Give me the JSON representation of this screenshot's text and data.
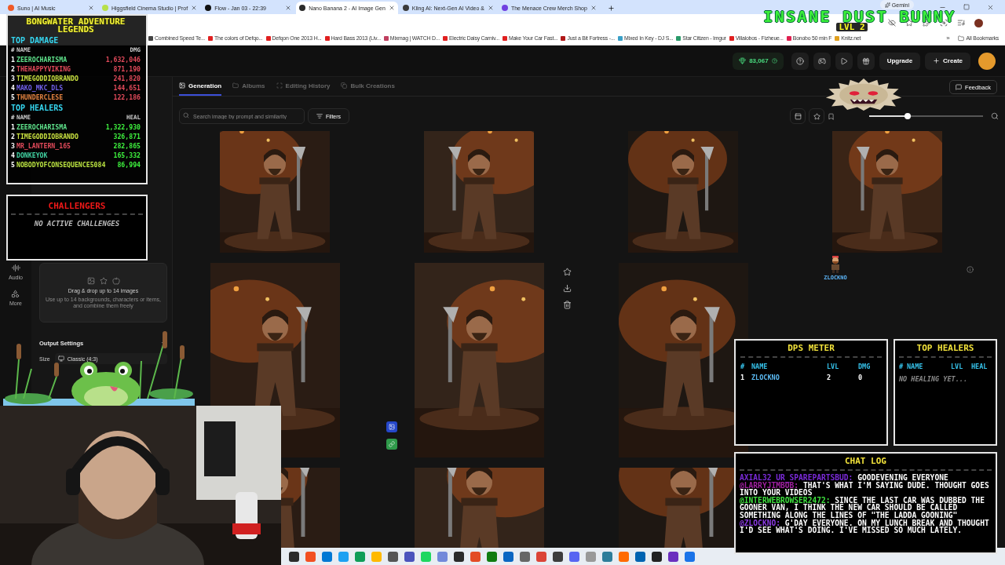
{
  "browser": {
    "tabs": [
      {
        "title": "Suno | AI Music",
        "selected": false,
        "color": "#f05a28"
      },
      {
        "title": "Higgsfield Cinema Studio | Prof",
        "selected": false,
        "color": "#b7e04a"
      },
      {
        "title": "Flow - Jan 03 - 22:39",
        "selected": false,
        "color": "#111111"
      },
      {
        "title": "Nano Banana 2 - AI Image Gen",
        "selected": true,
        "color": "#2a2a2a"
      },
      {
        "title": "Kling AI: Next-Gen AI Video &",
        "selected": false,
        "color": "#3a3a3a"
      },
      {
        "title": "The Menace Crew Merch Shop",
        "selected": false,
        "color": "#7040e0"
      }
    ],
    "gemini": "Gemini",
    "bookmarks": [
      {
        "title": "Combined Speed Te...",
        "color": "#444444"
      },
      {
        "title": "The colors of Defqo...",
        "color": "#e02020"
      },
      {
        "title": "Defqon One 2013 H...",
        "color": "#e02020"
      },
      {
        "title": "Hard Bass 2013 (Liv...",
        "color": "#e02020"
      },
      {
        "title": "Mixmag | WATCH D...",
        "color": "#c04060"
      },
      {
        "title": "Electric Daisy Carniv...",
        "color": "#e02020"
      },
      {
        "title": "Make Your Car Fast...",
        "color": "#e02020"
      },
      {
        "title": "Just a Bit Fortress -...",
        "color": "#b01818"
      },
      {
        "title": "Mixed In Key - DJ S...",
        "color": "#3aa0c8"
      },
      {
        "title": "Star Citizen - Imgur",
        "color": "#2a9a6a"
      },
      {
        "title": "Villalobos - Fizheue...",
        "color": "#e02020"
      },
      {
        "title": "Bonobo 50 min F",
        "color": "#e02050"
      },
      {
        "title": "Knitz.net",
        "color": "#e0a020"
      }
    ],
    "more_bookmarks": "»",
    "all_bookmarks": "All Bookmarks"
  },
  "app": {
    "credits": "83,067",
    "upgrade": "Upgrade",
    "create": "Create",
    "tabs": [
      {
        "label": "Generation",
        "selected": true
      },
      {
        "label": "Albums",
        "selected": false
      },
      {
        "label": "Editing History",
        "selected": false
      },
      {
        "label": "Bulk Creations",
        "selected": false
      }
    ],
    "feedback": "Feedback",
    "nav": [
      {
        "label": "Audio"
      },
      {
        "label": "More"
      }
    ],
    "upload": {
      "title": "Drag & drop up to 14 images",
      "hint": "Use up to 14 backgrounds, characters or items, and combine them freely"
    },
    "output": {
      "title": "Output Settings",
      "size_label": "Size",
      "size_value": "Classic (4:3)"
    },
    "search_placeholder": "Search image by prompt and similarity",
    "filters": "Filters",
    "zoom_slider": {
      "level": 0.34
    }
  },
  "overlay": {
    "streamer": {
      "name": "INSANE DUST BUNNY",
      "level": "LVL 2"
    },
    "leaderboard": {
      "title": "BONGWATER ADVENTURE LEGENDS",
      "sections": [
        {
          "kind": "damage",
          "title": "TOP DAMAGE",
          "columns": [
            "#",
            "NAME",
            "DMG"
          ],
          "rows": [
            {
              "rank": "1",
              "name": "ZEEROCHARISMA",
              "value": "1,632,046",
              "color": "#5ee08a"
            },
            {
              "rank": "2",
              "name": "THEHAPPYVIKING",
              "value": "871,190",
              "color": "#e04a5a"
            },
            {
              "rank": "3",
              "name": "TIMEGODDIOBRANDO",
              "value": "241,820",
              "color": "#c8e040"
            },
            {
              "rank": "4",
              "name": "MAKO_MKC_DLS",
              "value": "144,651",
              "color": "#7060e8"
            },
            {
              "rank": "5",
              "name": "THUNDERCLESE",
              "value": "122,186",
              "color": "#e08040"
            }
          ]
        },
        {
          "kind": "heal",
          "title": "TOP HEALERS",
          "columns": [
            "#",
            "NAME",
            "HEAL"
          ],
          "rows": [
            {
              "rank": "1",
              "name": "ZEEROCHARISMA",
              "value": "1,322,930",
              "color": "#5ee08a"
            },
            {
              "rank": "2",
              "name": "TIMEGODDIOBRANDO",
              "value": "326,871",
              "color": "#c8e040"
            },
            {
              "rank": "3",
              "name": "MR_LANTERN_165",
              "value": "282,865",
              "color": "#e04a5a"
            },
            {
              "rank": "4",
              "name": "DONKEYOK",
              "value": "165,332",
              "color": "#40d0a0"
            },
            {
              "rank": "5",
              "name": "NOBODYOFCONSEQUENCE5084",
              "value": "86,994",
              "color": "#b8e040"
            }
          ]
        }
      ]
    },
    "challengers": {
      "title": "CHALLENGERS",
      "empty": "NO ACTIVE CHALLENGES"
    },
    "viewer": {
      "name": "ZLOCKNO"
    },
    "dps": {
      "title": "DPS METER",
      "columns": [
        "#",
        "NAME",
        "LVL",
        "DMG"
      ],
      "rows": [
        {
          "rank": "1",
          "name": "ZLOCKNO",
          "lvl": "2",
          "dmg": "0"
        }
      ]
    },
    "healers": {
      "title": "TOP HEALERS",
      "columns": [
        "#",
        "NAME",
        "LVL",
        "HEAL"
      ],
      "empty": "NO HEALING YET..."
    },
    "chat": {
      "title": "CHAT LOG",
      "messages": [
        {
          "user": "AXIAL32_UR_SPAREPARTSBUD:",
          "color": "#7a2ad8",
          "text": "GOODEVENING EVERYONE"
        },
        {
          "user": "@LARRYJIMBOB:",
          "color": "#a020a0",
          "text": "THAT'S WHAT I'M SAYING DUDE. THOUGHT GOES INTO YOUR VIDEOS"
        },
        {
          "user": "@INTERWEBROWSER2472:",
          "color": "#3ee03e",
          "text": "SINCE THE LAST CAR WAS DUBBED THE GOONER VAN, I THINK THE NEW CAR SHOULD BE CALLED SOMETHING ALONG THE LINES OF \"THE LADDA GOONING\""
        },
        {
          "user": "@ZLOCKNO:",
          "color": "#8a3ae0",
          "text": "G'DAY EVERYONE. ON MY LUNCH BREAK AND THOUGHT I'D SEE WHAT'S DOING. I'VE MISSED SO MUCH LATELY."
        }
      ]
    }
  }
}
